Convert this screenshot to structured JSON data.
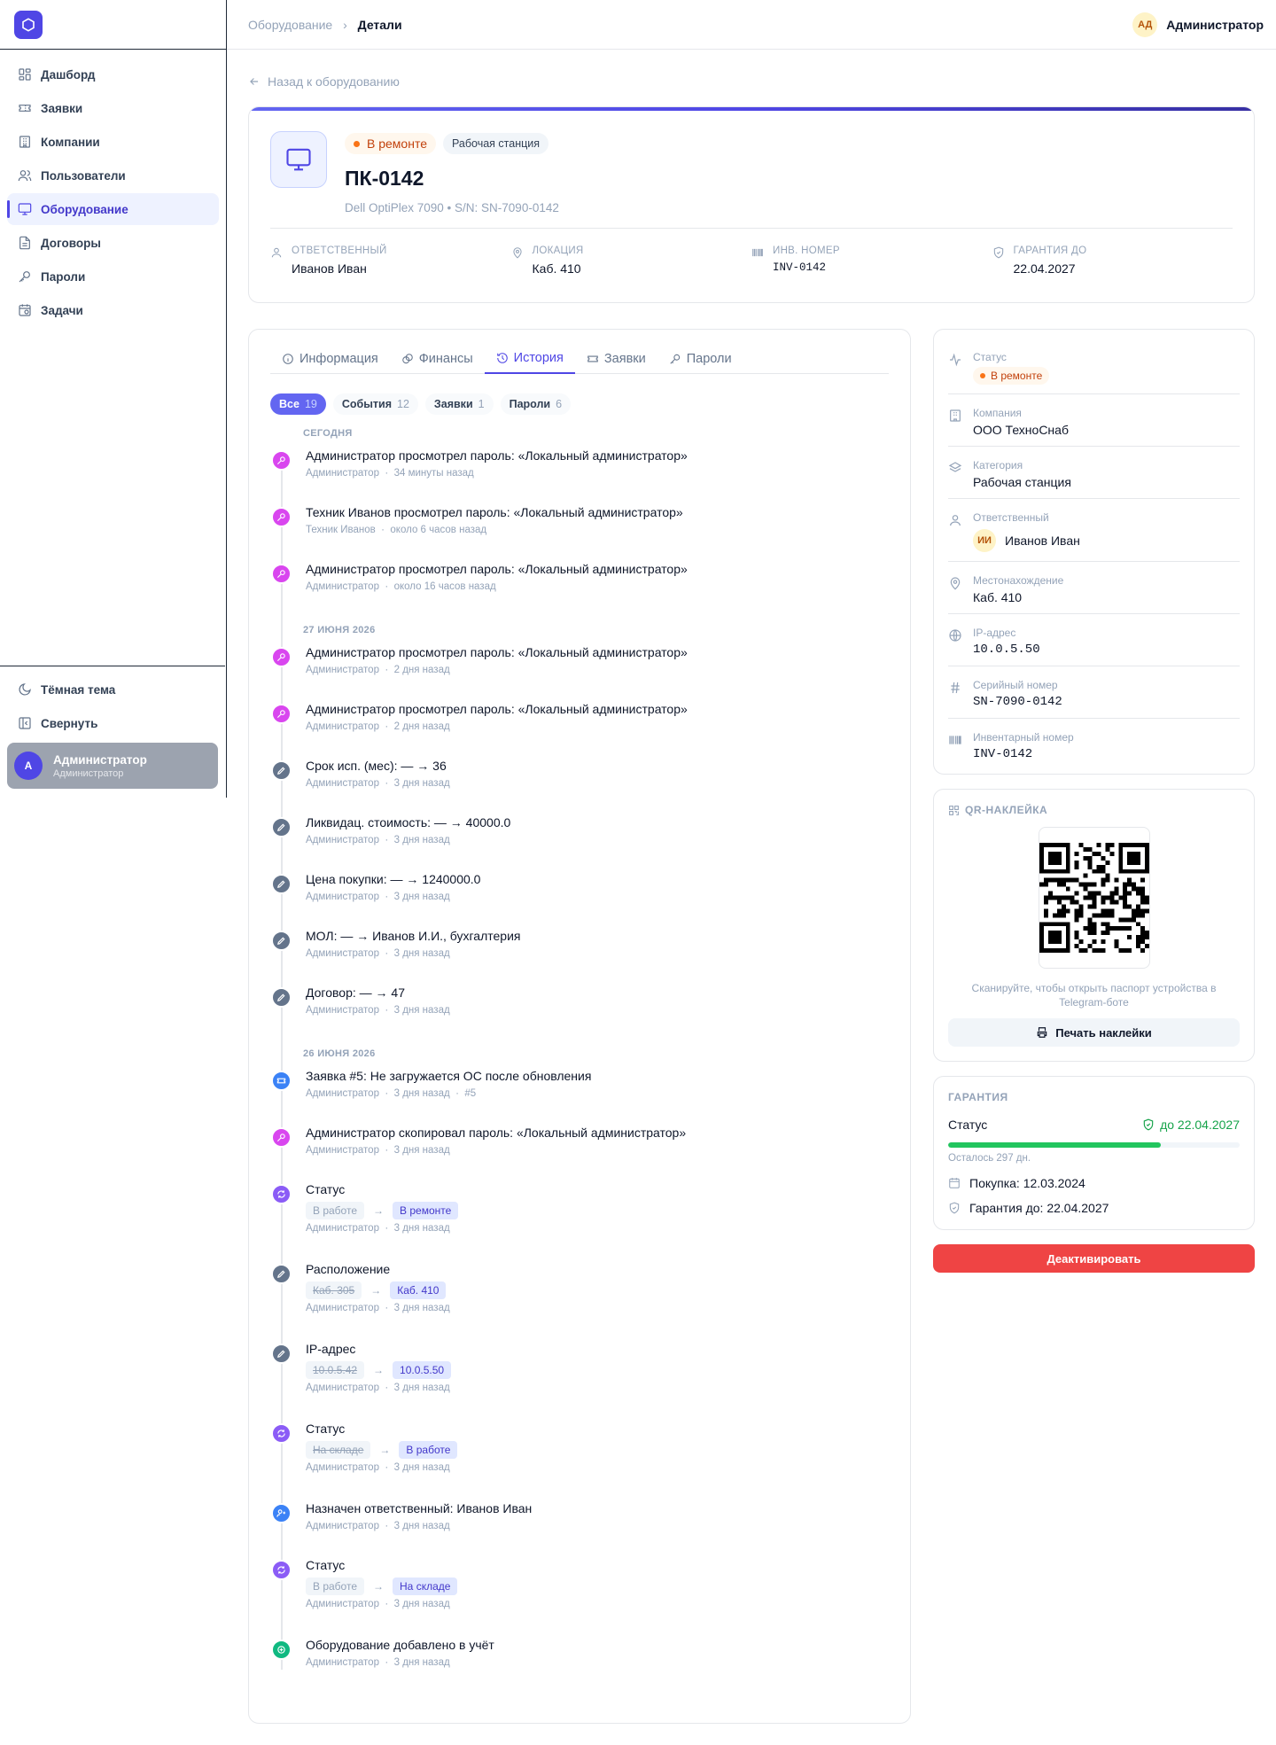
{
  "sidebar": {
    "items": [
      {
        "label": "Дашборд",
        "icon": "dashboard-icon"
      },
      {
        "label": "Заявки",
        "icon": "ticket-icon"
      },
      {
        "label": "Компании",
        "icon": "building-icon"
      },
      {
        "label": "Пользователи",
        "icon": "users-icon"
      },
      {
        "label": "Оборудование",
        "icon": "monitor-icon",
        "active": true
      },
      {
        "label": "Договоры",
        "icon": "document-icon"
      },
      {
        "label": "Пароли",
        "icon": "key-icon"
      },
      {
        "label": "Задачи",
        "icon": "calendar-check-icon"
      }
    ],
    "theme_label": "Тёмная тема",
    "collapse_label": "Свернуть",
    "user": {
      "initial": "А",
      "name": "Администратор",
      "role": "Администратор"
    }
  },
  "topbar": {
    "crumb_parent": "Оборудование",
    "crumb_current": "Детали",
    "user_initials": "АД",
    "user_name": "Администратор"
  },
  "back_label": "Назад к оборудованию",
  "device": {
    "status": "В ремонте",
    "type": "Рабочая станция",
    "name": "ПК-0142",
    "subtitle": "Dell OptiPlex 7090 • S/N: SN-7090-0142",
    "facts": [
      {
        "key": "Ответственный",
        "value": "Иванов Иван",
        "icon": "user-icon"
      },
      {
        "key": "Локация",
        "value": "Каб. 410",
        "icon": "location-icon"
      },
      {
        "key": "Инв. номер",
        "value": "INV-0142",
        "icon": "barcode-icon"
      },
      {
        "key": "Гарантия до",
        "value": "22.04.2027",
        "icon": "shield-icon"
      }
    ]
  },
  "tabs": [
    "Информация",
    "Финансы",
    "История",
    "Заявки",
    "Пароли"
  ],
  "filters": [
    {
      "label": "Все",
      "count": "19"
    },
    {
      "label": "События",
      "count": "12"
    },
    {
      "label": "Заявки",
      "count": "1"
    },
    {
      "label": "Пароли",
      "count": "6"
    }
  ],
  "history": {
    "groups": [
      "Сегодня",
      "27 июня 2026",
      "26 июня 2026"
    ],
    "events": [
      {
        "title": "Администратор просмотрел пароль: «Локальный администратор»",
        "author": "Администратор",
        "time": "34 минуты назад"
      },
      {
        "title": "Техник Иванов просмотрел пароль: «Локальный администратор»",
        "author": "Техник Иванов",
        "time": "около 6 часов назад"
      },
      {
        "title": "Администратор просмотрел пароль: «Локальный администратор»",
        "author": "Администратор",
        "time": "около 16 часов назад"
      },
      {
        "title": "Администратор просмотрел пароль: «Локальный администратор»",
        "author": "Администратор",
        "time": "2 дня назад"
      },
      {
        "title": "Администратор просмотрел пароль: «Локальный администратор»",
        "author": "Администратор",
        "time": "2 дня назад"
      },
      {
        "title": "Срок исп. (мес): — → 36",
        "author": "Администратор",
        "time": "3 дня назад"
      },
      {
        "title": "Ликвидац. стоимость: — → 40000.0",
        "author": "Администратор",
        "time": "3 дня назад"
      },
      {
        "title": "Цена покупки: — → 1240000.0",
        "author": "Администратор",
        "time": "3 дня назад"
      },
      {
        "title": "МОЛ: — → Иванов И.И., бухгалтерия",
        "author": "Администратор",
        "time": "3 дня назад"
      },
      {
        "title": "Договор: — → 47",
        "author": "Администратор",
        "time": "3 дня назад"
      },
      {
        "title": "Заявка #5: Не загружается ОС после обновления",
        "author": "Администратор",
        "time": "3 дня назад",
        "ref": "#5"
      },
      {
        "title": "Администратор скопировал пароль: «Локальный администратор»",
        "author": "Администратор",
        "time": "3 дня назад"
      },
      {
        "title": "Статус",
        "from": "В работе",
        "to": "В ремонте",
        "author": "Администратор",
        "time": "3 дня назад"
      },
      {
        "title": "Расположение",
        "from": "Каб. 305",
        "to": "Каб. 410",
        "author": "Администратор",
        "time": "3 дня назад"
      },
      {
        "title": "IP-адрес",
        "from": "10.0.5.42",
        "to": "10.0.5.50",
        "author": "Администратор",
        "time": "3 дня назад"
      },
      {
        "title": "Статус",
        "from": "На складе",
        "to": "В работе",
        "author": "Администратор",
        "time": "3 дня назад"
      },
      {
        "title": "Назначен ответственный: Иванов Иван",
        "author": "Администратор",
        "time": "3 дня назад"
      },
      {
        "title": "Статус",
        "from": "В работе",
        "to": "На складе",
        "author": "Администратор",
        "time": "3 дня назад"
      },
      {
        "title": "Оборудование добавлено в учёт",
        "author": "Администратор",
        "time": "3 дня назад"
      }
    ]
  },
  "props": [
    {
      "key": "Статус",
      "value": "В ремонте",
      "icon": "activity-icon"
    },
    {
      "key": "Компания",
      "value": "ООО ТехноСнаб",
      "icon": "building-icon"
    },
    {
      "key": "Категория",
      "value": "Рабочая станция",
      "icon": "layers-icon"
    },
    {
      "key": "Ответственный",
      "value": "Иванов Иван",
      "initials": "ИИ",
      "icon": "user-icon"
    },
    {
      "key": "Местонахождение",
      "value": "Каб. 410",
      "icon": "location-icon"
    },
    {
      "key": "IP-адрес",
      "value": "10.0.5.50",
      "icon": "globe-icon"
    },
    {
      "key": "Серийный номер",
      "value": "SN-7090-0142",
      "icon": "hash-icon"
    },
    {
      "key": "Инвентарный номер",
      "value": "INV-0142",
      "icon": "barcode-icon"
    }
  ],
  "qr": {
    "title": "QR-наклейка",
    "caption": "Сканируйте, чтобы открыть паспорт устройства в Telegram-боте",
    "print_label": "Печать наклейки"
  },
  "warranty": {
    "title": "Гарантия",
    "status_label": "Статус",
    "status_value": "до 22.04.2027",
    "progress": 0.73,
    "remaining": "Осталось 297 дн.",
    "purchase_label": "Покупка:",
    "purchase_date": "12.03.2024",
    "warranty_label": "Гарантия до:",
    "warranty_date": "22.04.2027"
  },
  "deactivate_label": "Деактивировать",
  "colors": {
    "accent": "#4f46e5",
    "password_event": "#d946ef",
    "edit_event": "#64748b",
    "ticket_event": "#3b82f6",
    "status_event": "#8b5cf6",
    "create_event": "#10b981",
    "danger": "#ef4444",
    "success": "#22c55e"
  }
}
